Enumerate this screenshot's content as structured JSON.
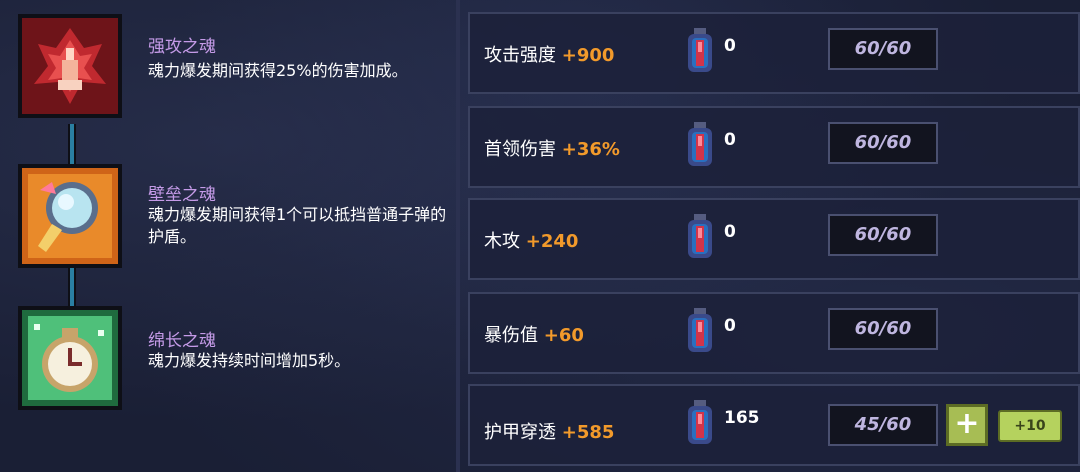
{
  "souls": [
    {
      "icon": "red-flower-soul-icon",
      "title": "强攻之魂",
      "desc": "魂力爆发期间获得25%的伤害加成。",
      "color": "#8b1c23"
    },
    {
      "icon": "shield-soul-icon",
      "title": "壁垒之魂",
      "desc": "魂力爆发期间获得1个可以抵挡普通子弹的护盾。",
      "color": "#d86a1e"
    },
    {
      "icon": "clock-soul-icon",
      "title": "绵长之魂",
      "desc": "魂力爆发持续时间增加5秒。",
      "color": "#2e9a5a"
    }
  ],
  "stats": [
    {
      "name": "攻击强度",
      "bonus": "+900",
      "potion_count": "0",
      "progress": "60/60",
      "progress_value": 1.0
    },
    {
      "name": "首领伤害",
      "bonus": "+36%",
      "potion_count": "0",
      "progress": "60/60",
      "progress_value": 1.0
    },
    {
      "name": "木攻",
      "bonus": "+240",
      "potion_count": "0",
      "progress": "60/60",
      "progress_value": 1.0
    },
    {
      "name": "暴伤值",
      "bonus": "+60",
      "potion_count": "0",
      "progress": "60/60",
      "progress_value": 1.0
    },
    {
      "name": "护甲穿透",
      "bonus": "+585",
      "potion_count": "165",
      "progress": "45/60",
      "progress_value": 0.75,
      "plus_label": "+",
      "plus10_label": "+10"
    }
  ],
  "colors": {
    "accent_orange": "#f29a2b",
    "soul_title": "#c59be8",
    "button_green": "#a7bd54"
  }
}
